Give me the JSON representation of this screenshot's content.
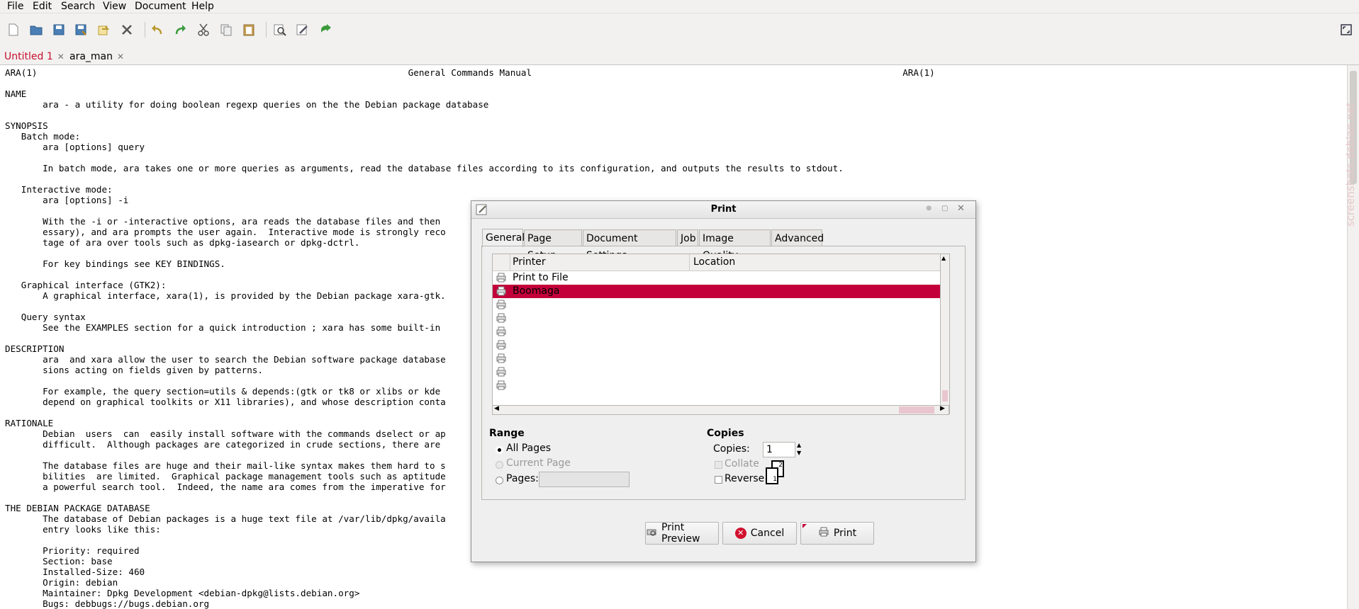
{
  "menubar": [
    "File",
    "Edit",
    "Search",
    "View",
    "Document",
    "Help"
  ],
  "toolbar": {
    "icons": [
      "new-file-icon",
      "open-file-icon",
      "save-icon",
      "save-as-icon",
      "revert-icon",
      "close-icon",
      "undo-icon",
      "redo-icon",
      "cut-icon",
      "copy-icon",
      "paste-icon",
      "find-icon",
      "preferences-icon",
      "jump-icon"
    ],
    "fullscreen_icon": "fullscreen-icon"
  },
  "tabs": [
    {
      "label": "Untitled 1",
      "color": "#c8102e"
    },
    {
      "label": "ara_man",
      "color": "#000000"
    }
  ],
  "editor": {
    "lines": [
      "ARA(1)                                                                     General Commands Manual                                                                     ARA(1)",
      "",
      "NAME",
      "       ara - a utility for doing boolean regexp queries on the the Debian package database",
      "",
      "SYNOPSIS",
      "   Batch mode:",
      "       ara [options] query",
      "",
      "       In batch mode, ara takes one or more queries as arguments, read the database files according to its configuration, and outputs the results to stdout.",
      "",
      "   Interactive mode:",
      "       ara [options] -i",
      "",
      "       With the -i or -interactive options, ara reads the database files and then                                                                 pager such as more or less if nec-",
      "       essary), and ara prompts the user again.  Interactive mode is strongly reco                                                               ite fast.  This is a major  advan-",
      "       tage of ara over tools such as dpkg-iasearch or dpkg-dctrl.",
      "",
      "       For key bindings see KEY BINDINGS.",
      "",
      "   Graphical interface (GTK2):",
      "       A graphical interface, xara(1), is provided by the Debian package xara-gtk.",
      "",
      "   Query syntax",
      "       See the EXAMPLES section for a quick introduction ; xara has some built-in",
      "",
      "DESCRIPTION",
      "       ara  and xara allow the user to search the Debian software package database                                                               an combinations of regular expres-",
      "       sions acting on fields given by patterns.",
      "",
      "       For example, the query section=utils & depends:(gtk or tk8 or xlibs or kde                                                                raphical interfaces (because  they",
      "       depend on graphical toolkits or X11 libraries), and whose description conta",
      "",
      "RATIONALE",
      "       Debian  users  can  easily install software with the commands dselect or ap                                                               ing the right package can be quite",
      "       difficult.  Although packages are categorized in crude sections, there are",
      "",
      "       The database files are huge and their mail-like syntax makes them hard to s                                                               or dpkg-dctrl(1) but  their  capa-",
      "       bilities  are limited.  Graphical package management tools such as aptitude                                                               ckages, its orientation is that of",
      "       a powerful search tool.  Indeed, the name ara comes from the imperative for",
      "",
      "THE DEBIAN PACKAGE DATABASE",
      "       The database of Debian packages is a huge text file at /var/lib/dpkg/availa                                                               box-like  format,  and  a  typical",
      "       entry looks like this:",
      "",
      "       Priority: required",
      "       Section: base",
      "       Installed-Size: 460",
      "       Origin: debian",
      "       Maintainer: Dpkg Development <debian-dpkg@lists.debian.org>",
      "       Bugs: debbugs://bugs.debian.org"
    ]
  },
  "watermark": "screenshots.debian.net",
  "dialog": {
    "title": "Print",
    "title_icon": "edit-document-icon",
    "window_buttons": [
      "up-icon",
      "maximize-icon",
      "close-icon"
    ],
    "tabs": [
      "General",
      "Page Setup",
      "Document Settings",
      "Job",
      "Image Quality",
      "Advanced"
    ],
    "printer_list": {
      "columns": [
        "Printer",
        "Location"
      ],
      "rows": [
        {
          "name": "Print to File",
          "location": "",
          "selected": false,
          "icon": "print-to-file-icon"
        },
        {
          "name": "Boomaga",
          "location": "",
          "selected": true,
          "icon": "printer-icon"
        },
        {
          "name": "",
          "location": "",
          "selected": false,
          "icon": "printer-icon"
        },
        {
          "name": "",
          "location": "",
          "selected": false,
          "icon": "printer-icon"
        },
        {
          "name": "",
          "location": "",
          "selected": false,
          "icon": "printer-icon"
        },
        {
          "name": "",
          "location": "",
          "selected": false,
          "icon": "printer-icon"
        },
        {
          "name": "",
          "location": "",
          "selected": false,
          "icon": "printer-icon"
        },
        {
          "name": "",
          "location": "",
          "selected": false,
          "icon": "printer-icon"
        },
        {
          "name": "",
          "location": "",
          "selected": false,
          "icon": "printer-icon"
        }
      ]
    },
    "range": {
      "heading": "Range",
      "all_pages": "All Pages",
      "current_page": "Current Page",
      "pages_label": "Pages:",
      "pages_value": "",
      "selected": "All Pages"
    },
    "copies": {
      "heading": "Copies",
      "copies_label": "Copies:",
      "copies_value": "1",
      "collate_label": "Collate",
      "collate_checked": false,
      "reverse_label": "Reverse",
      "reverse_checked": false,
      "collate_diagram": [
        "1",
        "2"
      ]
    },
    "buttons": {
      "preview": "Print Preview",
      "cancel": "Cancel",
      "print": "Print"
    },
    "accent_color": "#c3003a"
  }
}
